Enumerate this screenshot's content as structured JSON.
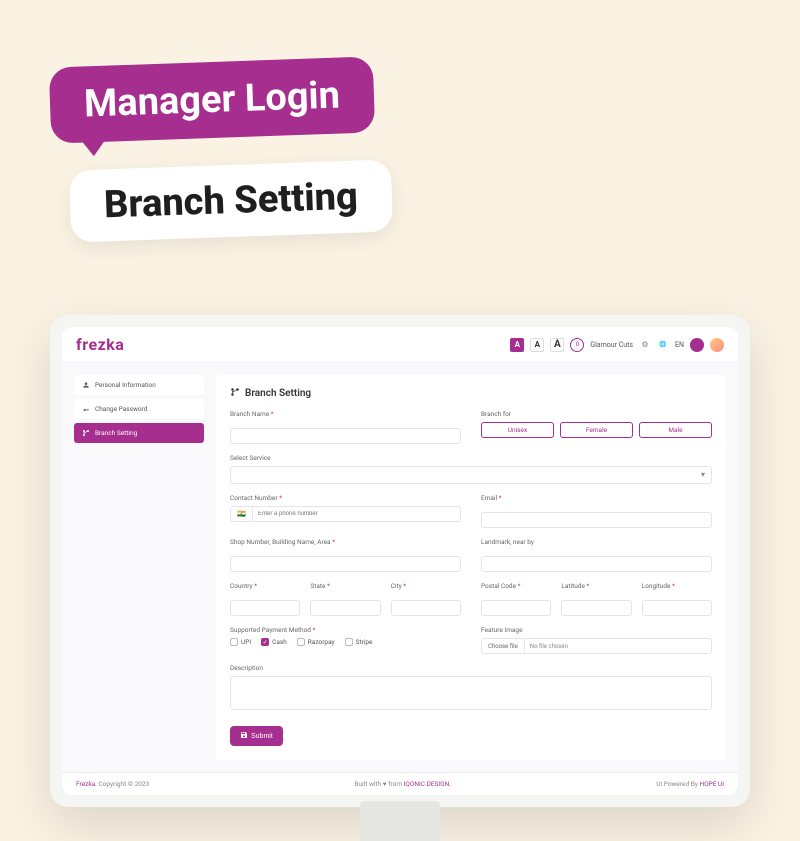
{
  "hero": {
    "title1": "Manager Login",
    "title2": "Branch Setting"
  },
  "topbar": {
    "logo": "frezka",
    "fontA": "A",
    "notif_count": "0",
    "user_name": "Glamour Cuts",
    "lang": "EN"
  },
  "sidebar": {
    "items": [
      {
        "label": "Personal Information",
        "active": false
      },
      {
        "label": "Change Password",
        "active": false
      },
      {
        "label": "Branch Setting",
        "active": true
      }
    ]
  },
  "page": {
    "title": "Branch Setting"
  },
  "form": {
    "branch_name_label": "Branch Name",
    "branch_for_label": "Branch for",
    "branch_for_options": [
      "Unisex",
      "Female",
      "Male"
    ],
    "select_service_label": "Select Service",
    "contact_number_label": "Contact Number",
    "phone_placeholder": "Enter a phone number",
    "email_label": "Email",
    "shop_label": "Shop Number, Building Name, Area",
    "landmark_label": "Landmark, near by",
    "country_label": "Country",
    "state_label": "State",
    "city_label": "City",
    "postal_label": "Postal Code",
    "latitude_label": "Latitude",
    "longitude_label": "Longitude",
    "payment_label": "Supported Payment Method",
    "payment_options": {
      "upi": "UPI",
      "cash": "Cash",
      "razorpay": "Razorpay",
      "stripe": "Stripe"
    },
    "feature_image_label": "Feature Image",
    "choose_file": "Choose file",
    "no_file": "No file chosen",
    "description_label": "Description",
    "submit": "Submit"
  },
  "footer": {
    "brand": "Frezka.",
    "copyright": " Copyright © 2023",
    "built_with": "Built with ♥ from ",
    "iqonic": "IQONIC DESIGN.",
    "powered": "UI Powered By ",
    "hope": "HOPE UI"
  }
}
